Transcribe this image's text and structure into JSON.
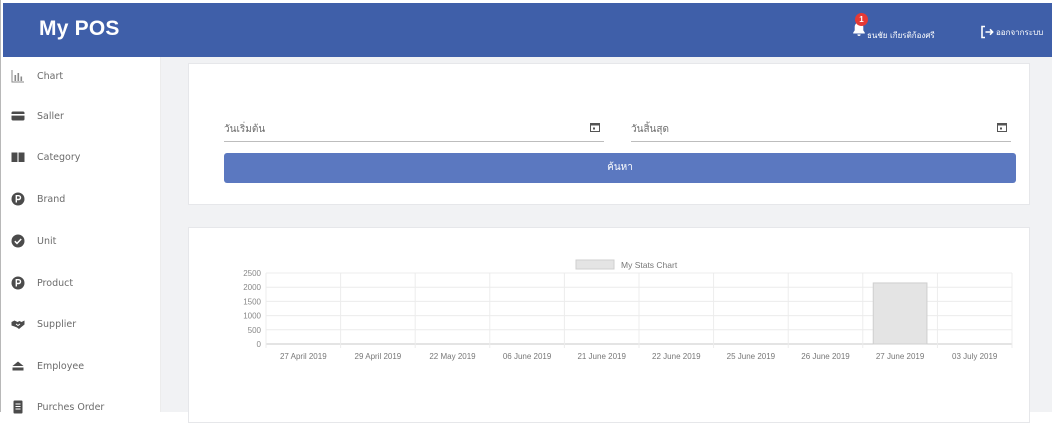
{
  "app": {
    "title": "My POS"
  },
  "header": {
    "notification_count": "1",
    "user_name": "ธนชัย เกียรติก้องศรี",
    "logout_label": "ออกจากระบบ"
  },
  "sidebar": {
    "items": [
      {
        "label": "Chart",
        "icon": "bar-chart-icon"
      },
      {
        "label": "Saller",
        "icon": "wallet-icon"
      },
      {
        "label": "Category",
        "icon": "book-icon"
      },
      {
        "label": "Brand",
        "icon": "circle-p-icon"
      },
      {
        "label": "Unit",
        "icon": "check-circle-icon"
      },
      {
        "label": "Product",
        "icon": "circle-p-icon"
      },
      {
        "label": "Supplier",
        "icon": "handshake-icon"
      },
      {
        "label": "Employee",
        "icon": "users-icon"
      },
      {
        "label": "Purches Order",
        "icon": "document-icon"
      }
    ]
  },
  "filter": {
    "start_date_placeholder": "วันเริ่มต้น",
    "end_date_placeholder": "วันสิ้นสุด",
    "search_label": "ค้นหา"
  },
  "colors": {
    "navbar": "#3f5fa9",
    "button": "#5b78c0",
    "bar_fill": "#e4e4e4",
    "bar_stroke": "#cfcfcf"
  },
  "chart_data": {
    "type": "bar",
    "categories": [
      "27 April 2019",
      "29 April 2019",
      "22 May 2019",
      "06 June 2019",
      "21 June 2019",
      "22 June 2019",
      "25 June 2019",
      "26 June 2019",
      "27 June 2019",
      "03 July 2019"
    ],
    "series": [
      {
        "name": "My Stats Chart",
        "values": [
          0,
          0,
          0,
          0,
          0,
          0,
          0,
          0,
          2150,
          0
        ]
      }
    ],
    "yticks": [
      "2500",
      "2000",
      "1500",
      "1000",
      "500",
      "0"
    ],
    "ylim": [
      0,
      2500
    ],
    "legend_position": "top",
    "grid": true
  }
}
